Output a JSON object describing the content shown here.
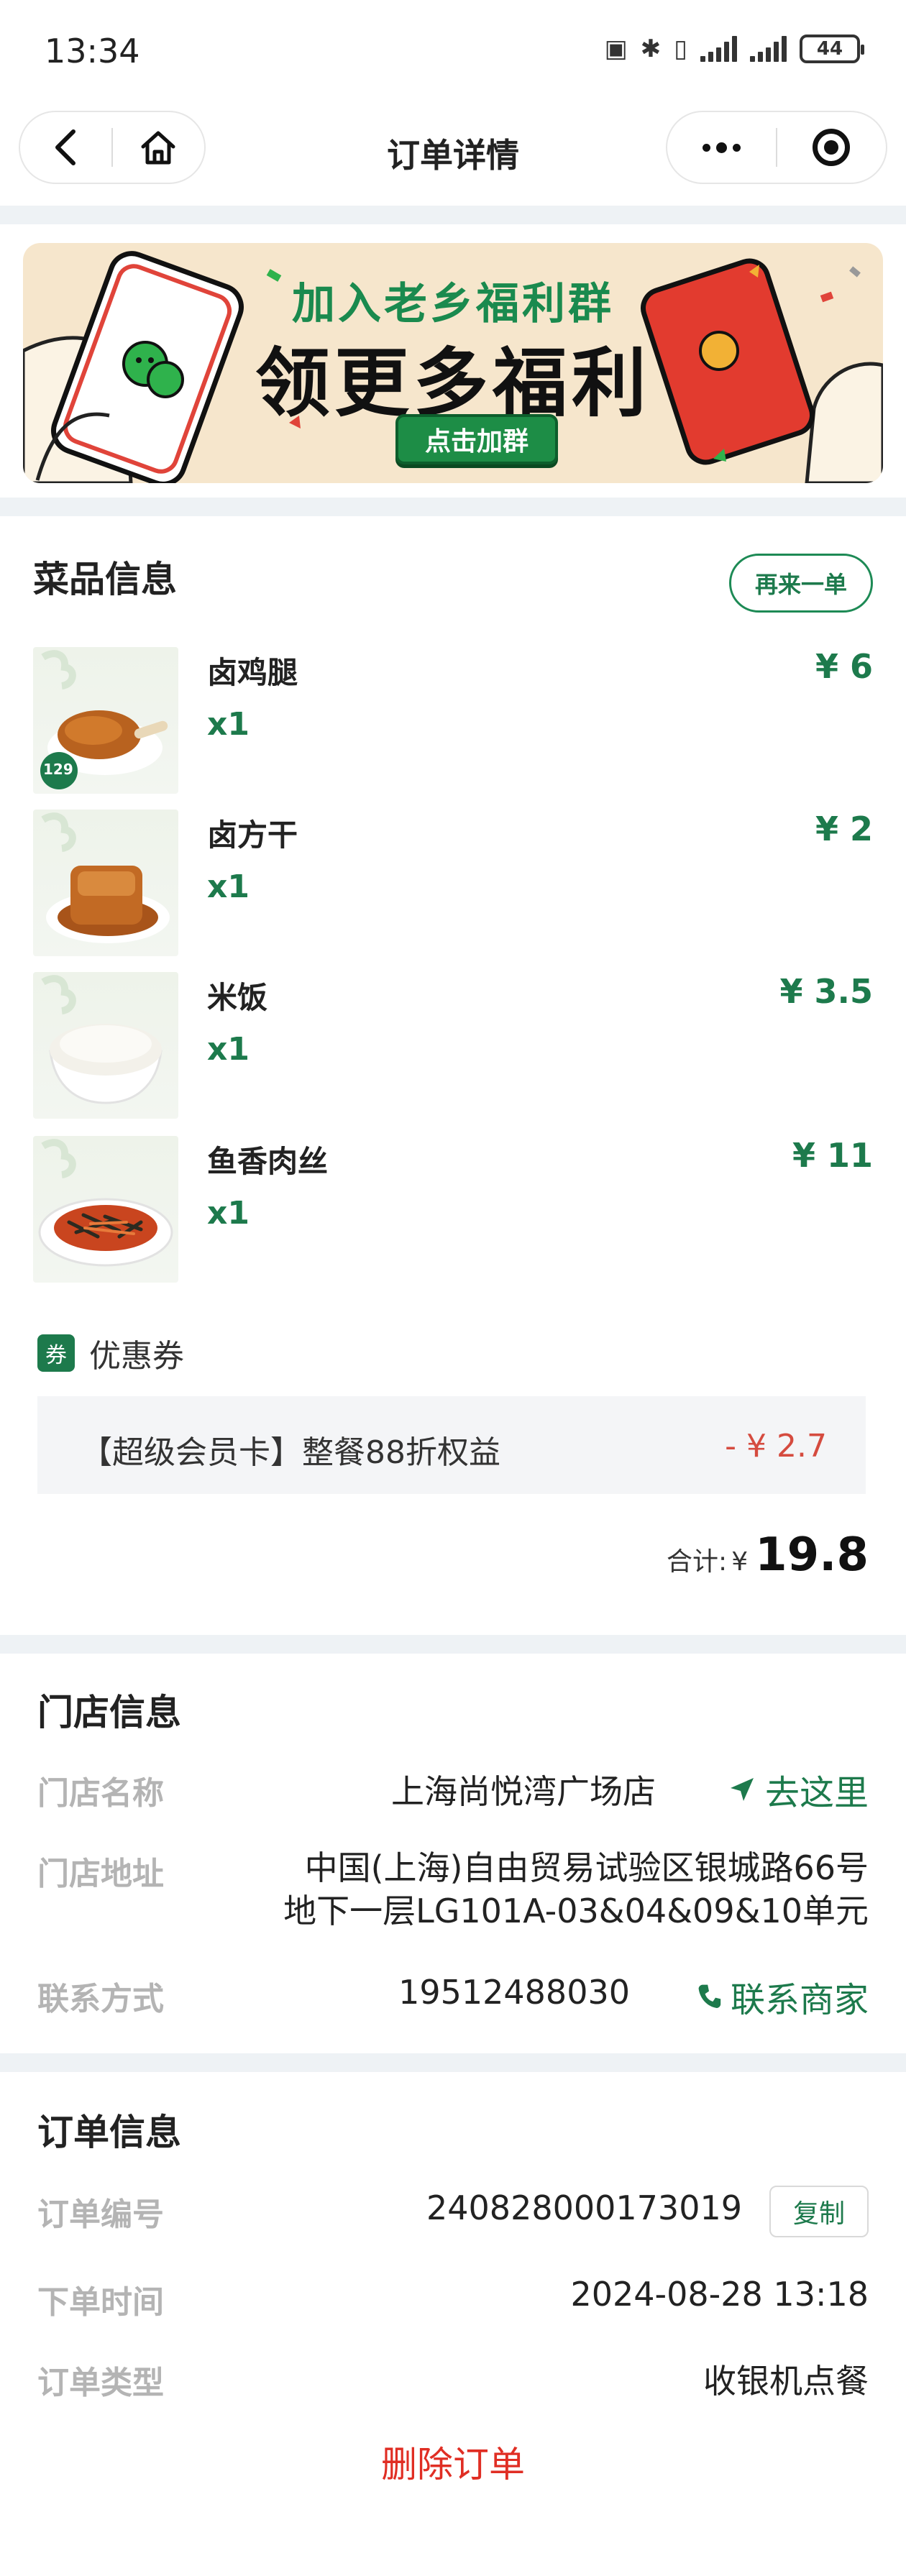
{
  "status_bar": {
    "time": "13:34",
    "battery": "44"
  },
  "nav": {
    "title": "订单详情"
  },
  "banner": {
    "line1": "加入老乡福利群",
    "line2": "领更多福利",
    "button": "点击加群"
  },
  "dishes_section": {
    "title": "菜品信息",
    "reorder_label": "再来一单",
    "items": [
      {
        "name": "卤鸡腿",
        "qty": "x1",
        "price": "¥ 6",
        "badge": "129"
      },
      {
        "name": "卤方干",
        "qty": "x1",
        "price": "¥ 2"
      },
      {
        "name": "米饭",
        "qty": "x1",
        "price": "¥ 3.5"
      },
      {
        "name": "鱼香肉丝",
        "qty": "x1",
        "price": "¥ 11"
      }
    ],
    "coupon": {
      "tag": "券",
      "label": "优惠券",
      "name": "【超级会员卡】整餐88折权益",
      "amount": "- ¥ 2.7"
    },
    "total": {
      "label": "合计:",
      "currency": "¥",
      "value": "19.8"
    }
  },
  "store_section": {
    "title": "门店信息",
    "name_label": "门店名称",
    "name": "上海尚悦湾广场店",
    "navigate_label": "去这里",
    "address_label": "门店地址",
    "address_line1": "中国(上海)自由贸易试验区银城路66号",
    "address_line2": "地下一层LG101A-03&04&09&10单元",
    "contact_label": "联系方式",
    "phone": "19512488030",
    "contact_action": "联系商家"
  },
  "order_section": {
    "title": "订单信息",
    "number_label": "订单编号",
    "number": "240828000173019",
    "copy_label": "复制",
    "time_label": "下单时间",
    "time": "2024-08-28 13:18",
    "type_label": "订单类型",
    "type": "收银机点餐",
    "delete_label": "删除订单"
  },
  "colors": {
    "accent": "#1d7a4c",
    "danger": "#e02e24",
    "coupon_red": "#d54b3f",
    "divider": "#eef2f5"
  }
}
